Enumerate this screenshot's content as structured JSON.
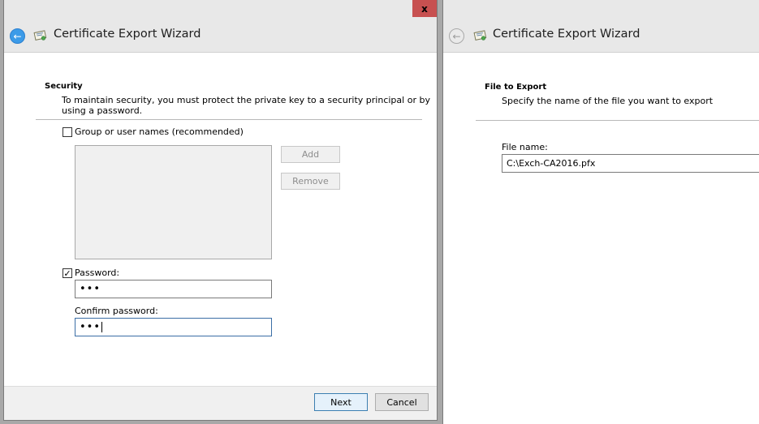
{
  "left_window": {
    "title": "Certificate Export Wizard",
    "close_glyph": "x",
    "section_heading": "Security",
    "section_description_line1": "To maintain security, you must protect the private key to a security principal or by",
    "section_description_line2": "using a password.",
    "group_checkbox": {
      "checked": false,
      "label": "Group or user names (recommended)"
    },
    "add_button": "Add",
    "remove_button": "Remove",
    "password_checkbox": {
      "checked": true,
      "label": "Password:"
    },
    "password_value": "•••",
    "confirm_label": "Confirm password:",
    "confirm_value": "•••",
    "next_button": "Next",
    "cancel_button": "Cancel"
  },
  "right_window": {
    "title": "Certificate Export Wizard",
    "section_heading": "File to Export",
    "section_description": "Specify the name of the file you want to export",
    "file_name_label": "File name:",
    "file_name_value": "C:\\Exch-CA2016.pfx"
  },
  "icons": {
    "back": "back-arrow-icon",
    "certificate": "certificate-icon",
    "close": "close-icon"
  },
  "colors": {
    "accent_back_button": "#3c9be8",
    "close_button": "#c75050",
    "default_button_border": "#3c7fb1"
  }
}
